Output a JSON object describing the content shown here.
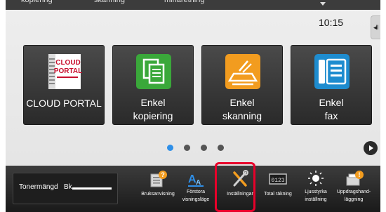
{
  "top_tabs": [
    "kopiering",
    "skanning",
    "minaretning"
  ],
  "clock": "10:15",
  "edge_tab_glyph": "◂II",
  "tiles": [
    {
      "label_lines": [
        "CLOUD PORTAL"
      ],
      "icon": "cloud-portal-icon",
      "logo_text": "CLOUD PORTAL",
      "color": "#c8102e"
    },
    {
      "label_lines": [
        "Enkel",
        "kopiering"
      ],
      "icon": "copy-icon",
      "color": "#3aa83a"
    },
    {
      "label_lines": [
        "Enkel",
        "skanning"
      ],
      "icon": "scan-icon",
      "color": "#f29c1f"
    },
    {
      "label_lines": [
        "Enkel",
        "fax"
      ],
      "icon": "fax-icon",
      "color": "#1e8ccf"
    }
  ],
  "pager": {
    "pages": 4,
    "current": 1
  },
  "toner": {
    "label": "Tonermängd",
    "color": "Bk",
    "level": 1.0
  },
  "quick_buttons": [
    {
      "label_lines": [
        "Bruksanvisning"
      ],
      "icon": "manual-icon"
    },
    {
      "label_lines": [
        "Förstora",
        "visningsläge"
      ],
      "icon": "enlarge-display-icon"
    },
    {
      "label_lines": [
        "Inställningar"
      ],
      "icon": "settings-icon"
    },
    {
      "label_lines": [
        "Total räkning"
      ],
      "icon": "counter-icon"
    },
    {
      "label_lines": [
        "Ljusstyrka",
        "inställning"
      ],
      "icon": "brightness-icon"
    },
    {
      "label_lines": [
        "Uppdragshand-",
        "läggning"
      ],
      "icon": "job-status-icon"
    }
  ],
  "colors": {
    "highlight": "#e8002a",
    "pager_active": "#2e8fe8"
  }
}
